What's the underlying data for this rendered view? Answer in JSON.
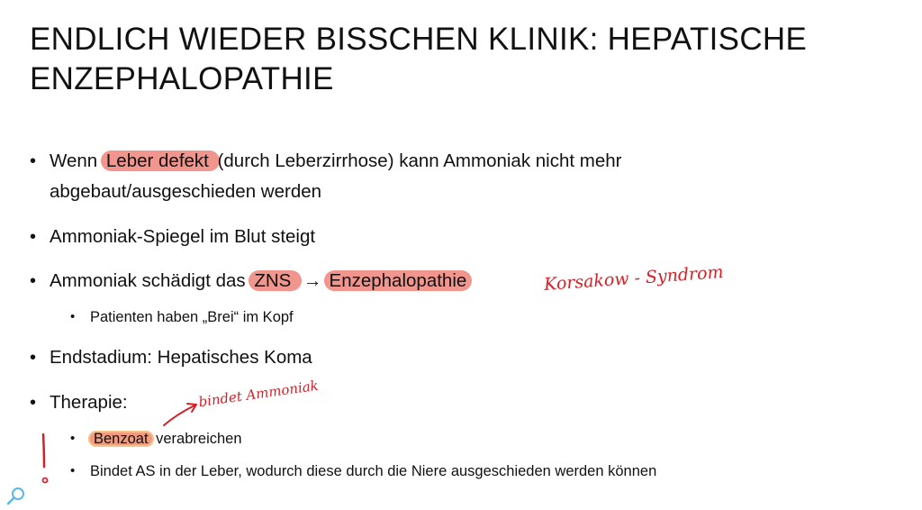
{
  "slide": {
    "title_line1": "ENDLICH WIEDER BISSCHEN KLINIK: HEPATISCHE",
    "title_line2": "ENZEPHALOPATHIE",
    "bullet1": {
      "pre": "Wenn ",
      "hl": "Leber defekt ",
      "post": "(durch Leberzirrhose) kann Ammoniak nicht mehr",
      "line2": "abgebaut/ausgeschieden werden"
    },
    "bullet2": "Ammoniak-Spiegel im Blut steigt",
    "bullet3": {
      "pre": "Ammoniak schädigt das ",
      "hl1": "ZNS ",
      "arrow": "→",
      "hl2": "Enzephalopathie"
    },
    "bullet3_sub": "Patienten haben „Brei“ im Kopf",
    "bullet4": "Endstadium: Hepatisches Koma",
    "bullet5": "Therapie:",
    "bullet5_sub1": {
      "hl": "Benzoat",
      "post": " verabreichen"
    },
    "bullet5_sub2": "Bindet AS in der Leber, wodurch diese durch die Niere ausgeschieden werden können",
    "bullet_char": "•"
  },
  "annotations": {
    "korsakow": "Korsakow - Syndrom",
    "bindet": "bindet Ammoniak",
    "exclaim": "!"
  },
  "colors": {
    "highlight_red": "#f0968e",
    "highlight_orange": "#f19a82",
    "ink_red": "#d61f26",
    "search_icon": "#5ab8e6"
  },
  "icons": {
    "search": "search-icon"
  }
}
